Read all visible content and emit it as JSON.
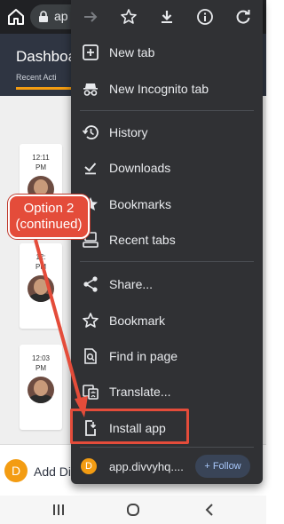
{
  "browser": {
    "url_text": "ap"
  },
  "page": {
    "title": "Dashboa",
    "tab_label": "Recent Acti",
    "feed": [
      {
        "time_lines": [
          "12:11",
          "PM"
        ]
      },
      {
        "time_lines": [
          "12:",
          "PM"
        ]
      },
      {
        "time_lines": [
          "12:03",
          "PM"
        ]
      }
    ],
    "bottom_avatar_letter": "D",
    "bottom_text": "Add Di"
  },
  "menu": {
    "top_icons": [
      "forward-icon",
      "star-icon",
      "download-icon",
      "info-icon",
      "refresh-icon"
    ],
    "items": [
      {
        "label": "New tab",
        "icon": "new-tab-icon"
      },
      {
        "label": "New Incognito tab",
        "icon": "incognito-icon"
      },
      {
        "label": "History",
        "icon": "history-icon"
      },
      {
        "label": "Downloads",
        "icon": "downloads-icon"
      },
      {
        "label": "Bookmarks",
        "icon": "bookmarks-icon"
      },
      {
        "label": "Recent tabs",
        "icon": "recent-tabs-icon"
      },
      {
        "label": "Share...",
        "icon": "share-icon"
      },
      {
        "label": "Bookmark",
        "icon": "bookmark-star-icon"
      },
      {
        "label": "Find in page",
        "icon": "find-in-page-icon"
      },
      {
        "label": "Translate...",
        "icon": "translate-icon"
      },
      {
        "label": "Install app",
        "icon": "install-app-icon"
      }
    ],
    "site": {
      "avatar_letter": "D",
      "name": "app.divvyhq....",
      "follow_label": "+ Follow"
    }
  },
  "annotation": {
    "line1": "Option 2",
    "line2": "(continued)",
    "color": "#e44c3a"
  }
}
